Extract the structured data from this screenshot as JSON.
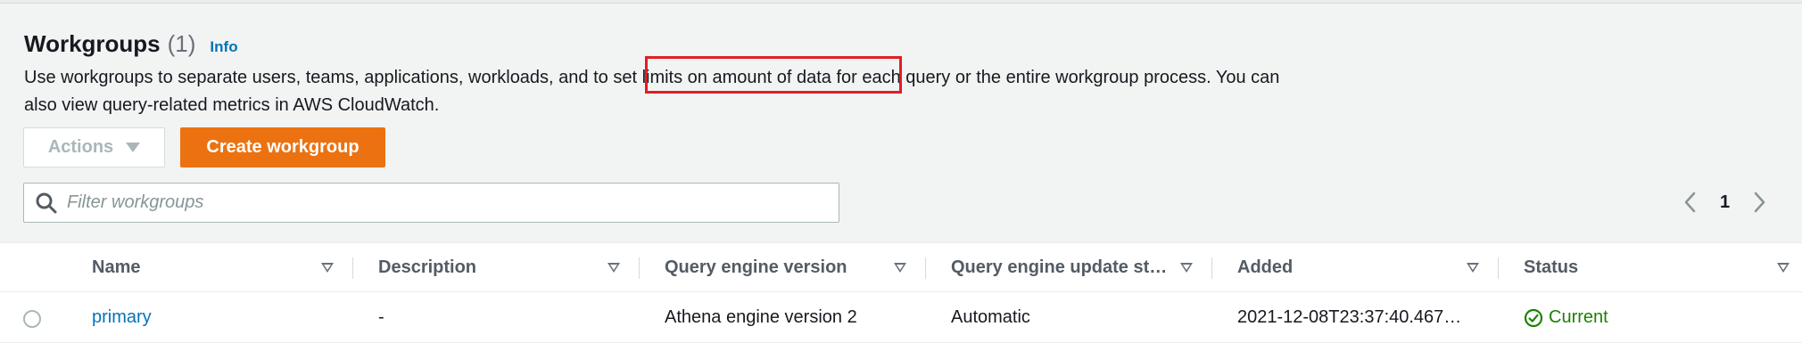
{
  "section": {
    "title": "Workgroups",
    "count": "(1)",
    "info_label": "Info",
    "description": "Use workgroups to separate users, teams, applications, workloads, and to set limits on amount of data for each query or the entire workgroup process. You can also view query-related metrics in AWS CloudWatch."
  },
  "toolbar": {
    "actions_label": "Actions",
    "create_label": "Create workgroup"
  },
  "filter": {
    "placeholder": "Filter workgroups",
    "value": ""
  },
  "pagination": {
    "current_page": "1"
  },
  "table": {
    "columns": [
      "Name",
      "Description",
      "Query engine version",
      "Query engine update st…",
      "Added",
      "Status"
    ],
    "rows": [
      {
        "selected": false,
        "name": "primary",
        "description": "-",
        "query_engine_version": "Athena engine version 2",
        "query_engine_update_status": "Automatic",
        "added": "2021-12-08T23:37:40.467…",
        "status": "Current"
      }
    ]
  },
  "colors": {
    "accent": "#ec7211",
    "link": "#0073bb",
    "success": "#1d8102",
    "highlight": "#e31c24"
  },
  "icons": [
    "search-icon",
    "chevron-left-icon",
    "chevron-right-icon",
    "sort-icon",
    "check-circle-icon",
    "caret-down-icon"
  ]
}
